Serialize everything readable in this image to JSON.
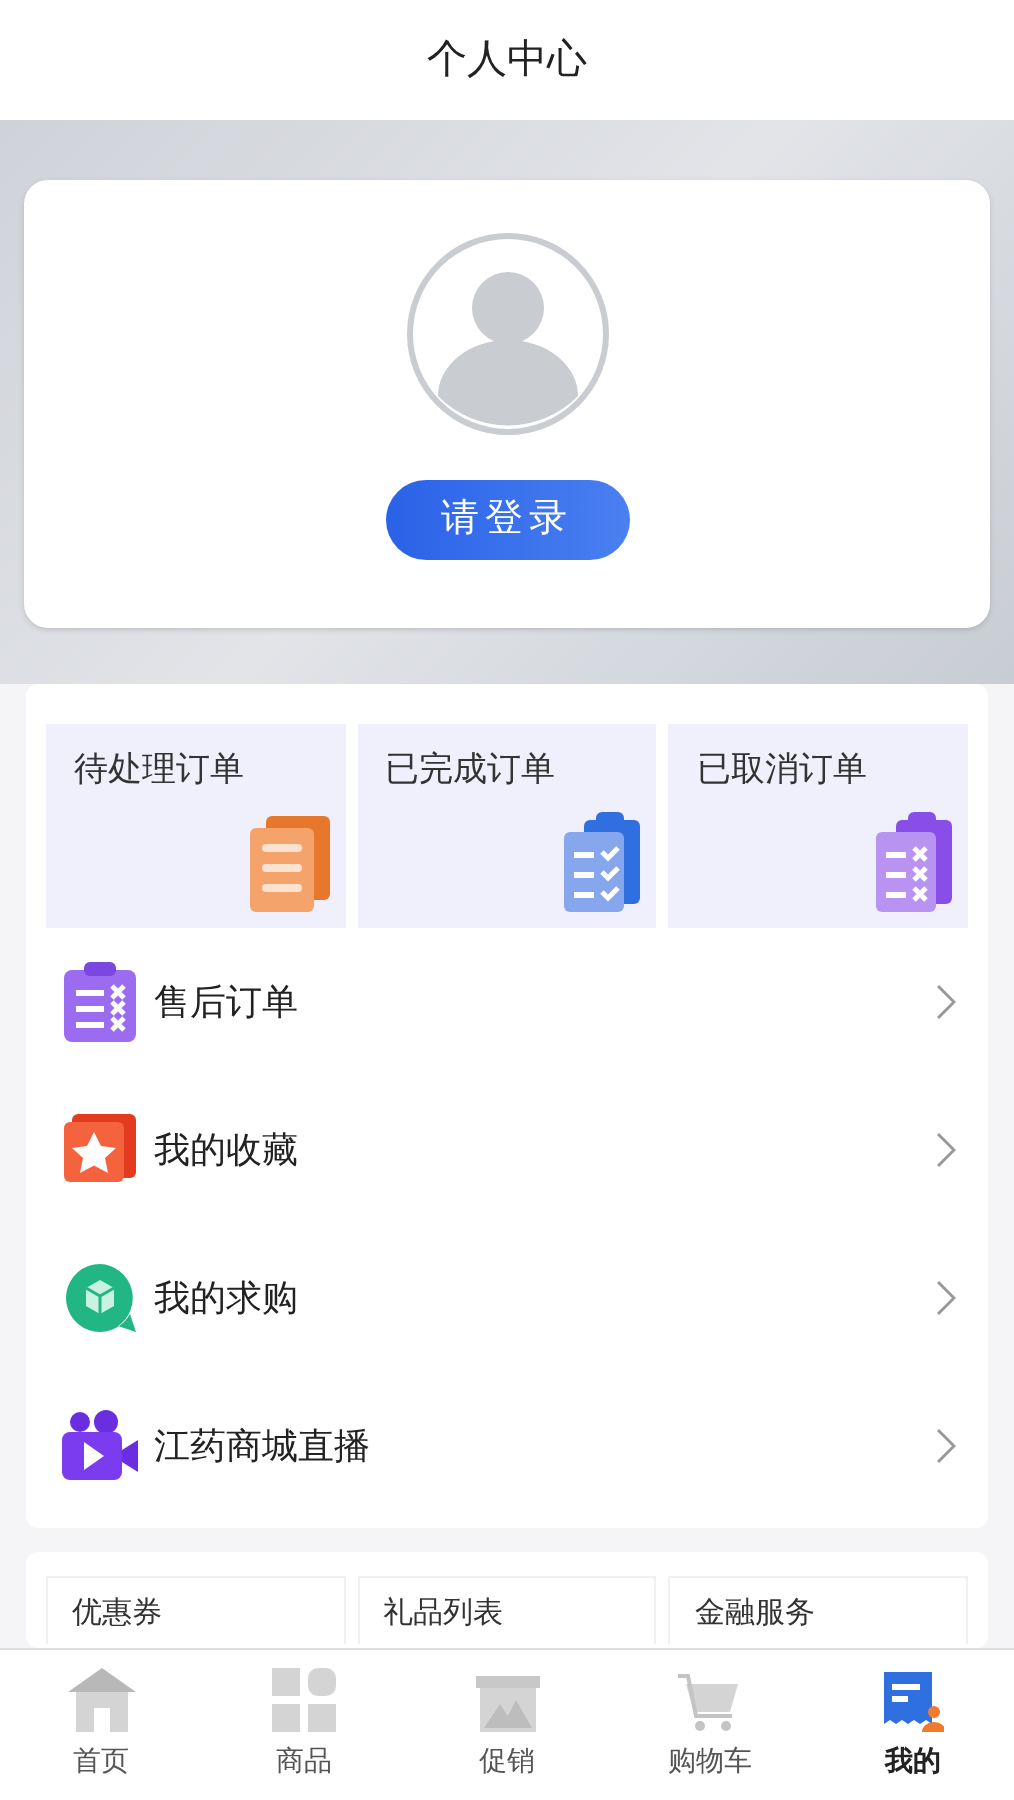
{
  "header": {
    "title": "个人中心"
  },
  "profile": {
    "login_button": "请登录"
  },
  "order_tiles": [
    {
      "label": "待处理订单"
    },
    {
      "label": "已完成订单"
    },
    {
      "label": "已取消订单"
    }
  ],
  "menu_items": [
    {
      "label": "售后订单"
    },
    {
      "label": "我的收藏"
    },
    {
      "label": "我的求购"
    },
    {
      "label": "江药商城直播"
    }
  ],
  "services": [
    {
      "label": "优惠券"
    },
    {
      "label": "礼品列表"
    },
    {
      "label": "金融服务"
    }
  ],
  "tab_bar": [
    {
      "label": "首页",
      "selected": false
    },
    {
      "label": "商品",
      "selected": false
    },
    {
      "label": "促销",
      "selected": false
    },
    {
      "label": "购物车",
      "selected": false
    },
    {
      "label": "我的",
      "selected": true
    }
  ]
}
